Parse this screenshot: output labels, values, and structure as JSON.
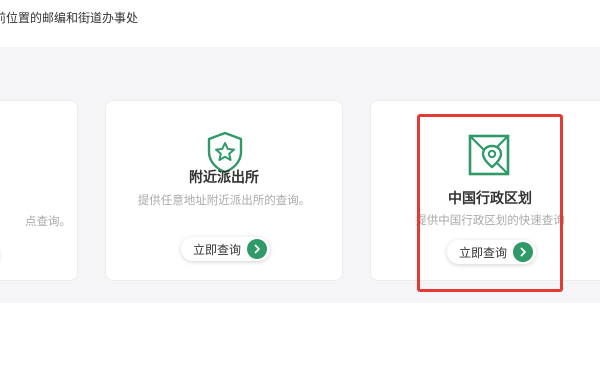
{
  "header": {
    "subtitle": "前位置的邮编和街道办事处"
  },
  "cards": {
    "left": {
      "desc_fragment": "点查询。"
    },
    "mid": {
      "title": "附近派出所",
      "desc": "提供任意地址附近派出所的查询。",
      "button": "立即查询",
      "icon": "shield-star-icon"
    },
    "right": {
      "title": "中国行政区划",
      "desc": "提供中国行政区划的快速查询",
      "button": "立即查询",
      "icon": "map-pin-icon"
    }
  },
  "colors": {
    "accent": "#2f9a68",
    "highlight": "#e53935"
  }
}
